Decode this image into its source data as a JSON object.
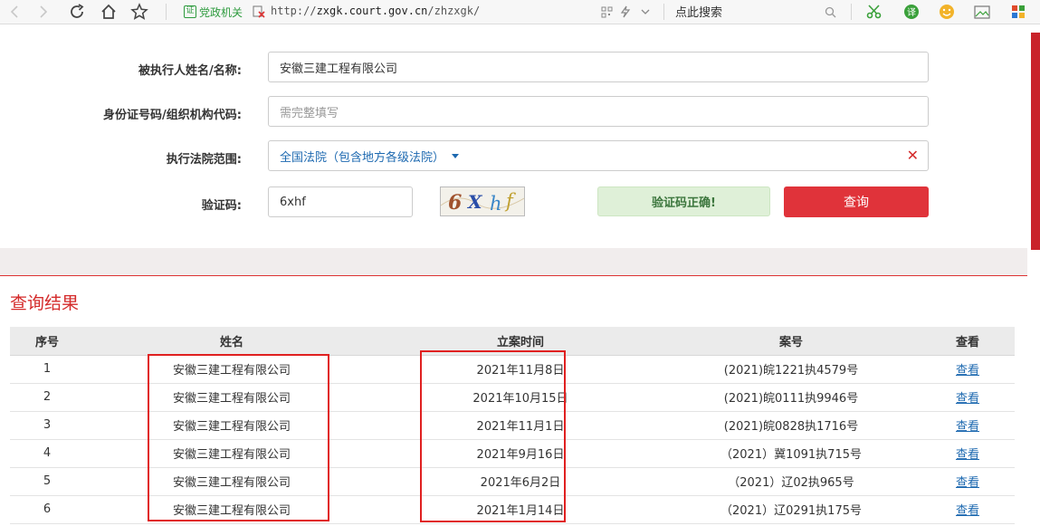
{
  "browser": {
    "badge_text": "党政机关",
    "badge_icon_text": "证",
    "url_prefix": "http://",
    "url_host": "zxgk.court.gov.cn",
    "url_path": "/zhzxgk/",
    "search_placeholder": "点此搜索"
  },
  "form": {
    "name_label": "被执行人姓名/名称:",
    "name_value": "安徽三建工程有限公司",
    "id_label": "身份证号码/组织机构代码:",
    "id_placeholder": "需完整填写",
    "court_label": "执行法院范围:",
    "court_value": "全国法院（包含地方各级法院）",
    "captcha_label": "验证码:",
    "captcha_value": "6xhf",
    "captcha_image_text": "6Xhf",
    "captcha_status": "验证码正确!",
    "query_button": "查询"
  },
  "results": {
    "title": "查询结果",
    "columns": [
      "序号",
      "姓名",
      "立案时间",
      "案号",
      "查看"
    ],
    "rows": [
      {
        "no": "1",
        "name": "安徽三建工程有限公司",
        "date": "2021年11月8日",
        "case": "(2021)皖1221执4579号",
        "view": "查看"
      },
      {
        "no": "2",
        "name": "安徽三建工程有限公司",
        "date": "2021年10月15日",
        "case": "(2021)皖0111执9946号",
        "view": "查看"
      },
      {
        "no": "3",
        "name": "安徽三建工程有限公司",
        "date": "2021年11月1日",
        "case": "(2021)皖0828执1716号",
        "view": "查看"
      },
      {
        "no": "4",
        "name": "安徽三建工程有限公司",
        "date": "2021年9月16日",
        "case": "（2021）冀1091执715号",
        "view": "查看"
      },
      {
        "no": "5",
        "name": "安徽三建工程有限公司",
        "date": "2021年6月2日",
        "case": "（2021）辽02执965号",
        "view": "查看"
      },
      {
        "no": "6",
        "name": "安徽三建工程有限公司",
        "date": "2021年1月14日",
        "case": "（2021）辽0291执175号",
        "view": "查看"
      }
    ]
  },
  "colors": {
    "accent_red": "#e0333a",
    "link_blue": "#1d69b0",
    "success_green": "#3c763d"
  }
}
